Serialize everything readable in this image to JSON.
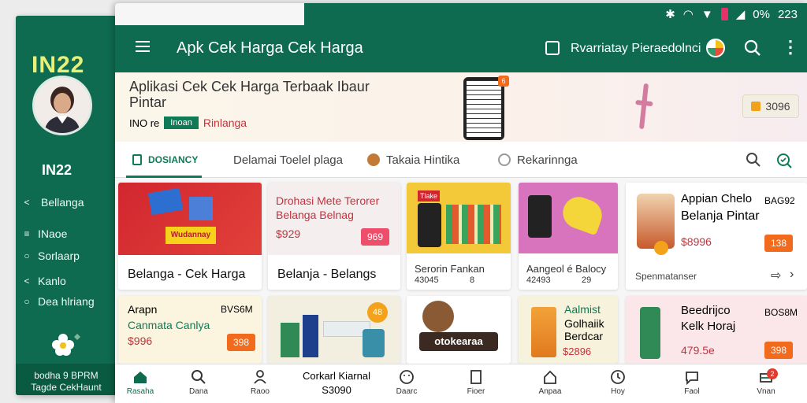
{
  "drawer": {
    "brand": "IN22",
    "user_name": "IN22",
    "items": [
      {
        "icon": "chevron-left-icon",
        "glyph": "<",
        "label": "Bellanga"
      },
      {
        "icon": "bars-icon",
        "glyph": "≡",
        "label": "INaoe"
      },
      {
        "icon": "shield-icon",
        "glyph": "○",
        "label": "Sorlaarp"
      },
      {
        "icon": "chevron-left-icon",
        "glyph": "<",
        "label": "Kanlo"
      },
      {
        "icon": "shield-icon",
        "glyph": "○",
        "label": "Dea hlriang"
      }
    ],
    "footer_line1": "bodha 9 BPRM",
    "footer_line2": "Tagde CekHaunt"
  },
  "statusbar": {
    "time": "223",
    "battery": "0%"
  },
  "appbar": {
    "title": "Apk Cek Harga Cek Harga",
    "account_label": "Rvarriatay Pieraedolnci"
  },
  "banner": {
    "headline_1": "Aplikasi Cek Cek Harga Terbaak Ibaur",
    "headline_2": "Pintar",
    "meta_prefix": "INO re",
    "chip": "Inoan",
    "meta_red": "Rinlanga",
    "price": "3096",
    "phone_badge": "6"
  },
  "tabs": [
    {
      "label": "DOSIANCY",
      "active": true
    },
    {
      "label": "Delamai Toelel plaga",
      "active": false
    },
    {
      "label": "Takaia Hintika",
      "active": false
    },
    {
      "label": "Rekarinnga",
      "active": false
    }
  ],
  "cards": {
    "c1": {
      "label": "Belanga - Cek Harga",
      "img_text": "Wudannay"
    },
    "c2": {
      "title_1": "Drohasi Mete Terorer",
      "title_2": "Belanga Belnag",
      "price": "$929",
      "tag": "969",
      "label": "Belanja - Belangs"
    },
    "c3": {
      "badge": "Tlake",
      "title": "Serorin Fankan",
      "code": "43045",
      "extra": "8"
    },
    "c4": {
      "title": "Aangeol é Balocy",
      "code": "42493",
      "extra": "29"
    },
    "c5": {
      "top": "Appian Chelo",
      "code": "BAG92",
      "title": "Belanja Pintar",
      "price": "$8996",
      "tag": "138",
      "footer": "Spenmatanser"
    },
    "c6": {
      "top": "Arapn",
      "code": "BVS6M",
      "title": "Canmata Canlya",
      "price": "$996",
      "tag": "398"
    },
    "c7": {
      "badge": "48"
    },
    "c8": {
      "banner": "otokearaa"
    },
    "c9": {
      "top": "Aalmist",
      "title_1": "Golhaiik",
      "title_2": "Berdcar",
      "price": "$2896"
    },
    "c10": {
      "top": "Beedrijco",
      "code": "BOS8M",
      "title": "Kelk Horaj",
      "price": "479.5e",
      "tag": "398"
    }
  },
  "bottom_nav": {
    "items": [
      {
        "label": "Rasaha",
        "active": true
      },
      {
        "label": "Dana"
      },
      {
        "label": "Raoo"
      },
      {
        "label": "Daarc"
      },
      {
        "label": "Fioer"
      },
      {
        "label": "Anpaa"
      },
      {
        "label": "Hoy"
      },
      {
        "label": "Faol"
      },
      {
        "label": "Vnan"
      }
    ],
    "mid_line1": "Corkarl Kiarnal",
    "mid_line2": "S3090",
    "badge": "2"
  },
  "colors": {
    "primary": "#0f6b4f",
    "accent": "#f26a1b",
    "brand_yellow": "#e6f07a"
  }
}
